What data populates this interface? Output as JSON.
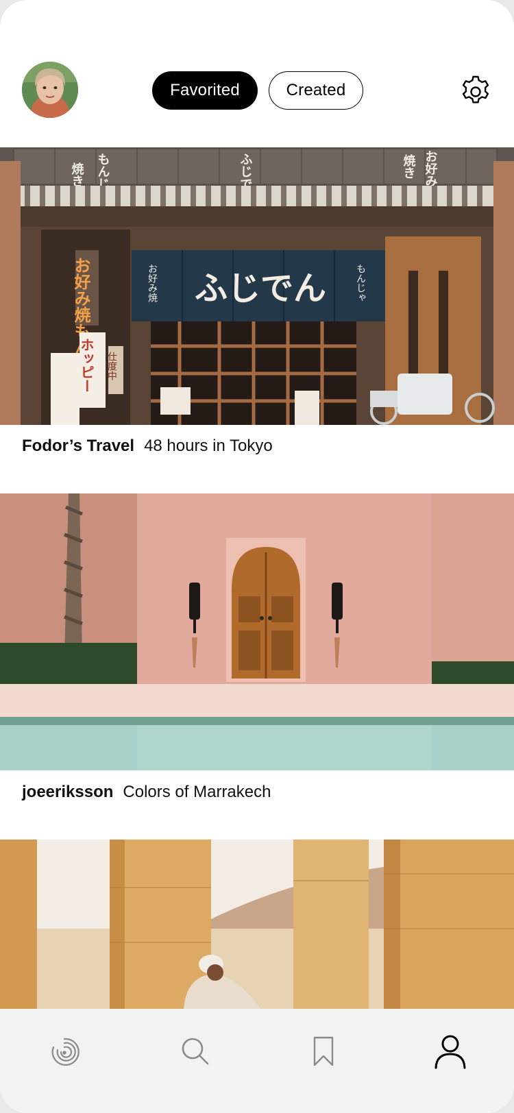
{
  "header": {
    "tabs": [
      {
        "label": "Favorited",
        "active": true
      },
      {
        "label": "Created",
        "active": false
      }
    ],
    "settings_icon": "gear-icon"
  },
  "feed": [
    {
      "author": "Fodor’s Travel",
      "title": "48 hours in Tokyo",
      "image": "tokyo-storefront"
    },
    {
      "author": "joeeriksson",
      "title": "Colors of Marrakech",
      "image": "marrakech-door-pool"
    },
    {
      "author": "",
      "title": "",
      "image": "desert-temple-columns"
    }
  ],
  "shop": {
    "curtain_text": "ふじでん",
    "curtain_side_left": "お好み焼",
    "curtain_side_right": "もんじゃ",
    "banner_text": "お好み焼もんじゃ焼",
    "sign_text": "ホッピー",
    "small_sign": "仕度中",
    "top_flags": [
      "焼き",
      "もんじゃ",
      "ふじでん",
      "焼き",
      "お好み"
    ]
  },
  "tabbar": {
    "items": [
      {
        "name": "home",
        "icon": "spiral-icon",
        "active": false
      },
      {
        "name": "search",
        "icon": "search-icon",
        "active": false
      },
      {
        "name": "saved",
        "icon": "bookmark-icon",
        "active": false
      },
      {
        "name": "profile",
        "icon": "profile-icon",
        "active": true
      }
    ]
  },
  "colors": {
    "background": "#ffffff",
    "primary": "#000000",
    "tabbar_bg": "#f2f2f2",
    "inactive_icon": "#8a8a8a"
  }
}
